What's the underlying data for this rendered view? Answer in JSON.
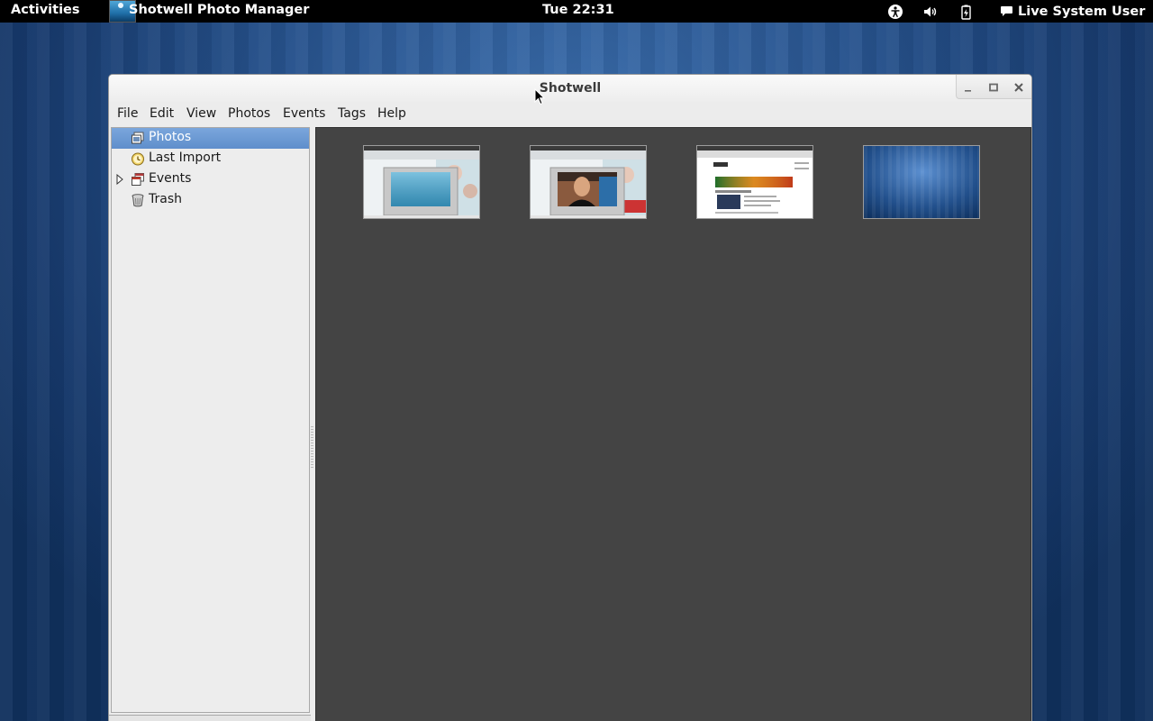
{
  "top_panel": {
    "activities_label": "Activities",
    "app_menu_label": "Shotwell Photo Manager",
    "clock": "Tue 22:31",
    "status_icons": [
      "accessibility-icon",
      "volume-icon",
      "battery-icon"
    ],
    "user_menu_label": "Live System User"
  },
  "window": {
    "title": "Shotwell",
    "controls": [
      "minimize",
      "maximize",
      "close"
    ]
  },
  "menubar": {
    "items": [
      "File",
      "Edit",
      "View",
      "Photos",
      "Events",
      "Tags",
      "Help"
    ]
  },
  "sidebar": {
    "items": [
      {
        "label": "Photos",
        "icon": "photos-icon",
        "selected": true
      },
      {
        "label": "Last Import",
        "icon": "last-import-icon",
        "selected": false
      },
      {
        "label": "Events",
        "icon": "events-icon",
        "selected": false,
        "expandable": true
      },
      {
        "label": "Trash",
        "icon": "trash-icon",
        "selected": false
      }
    ]
  },
  "photos": {
    "thumbnails": [
      {
        "kind": "desktop-screenshot-dialog"
      },
      {
        "kind": "desktop-screenshot-video"
      },
      {
        "kind": "web-page-screenshot"
      },
      {
        "kind": "blue-wallpaper"
      }
    ]
  },
  "colors": {
    "panel_bg": "#000000",
    "viewer_bg": "#444444",
    "selection_bg": "#6b97d0",
    "window_bg": "#ececec"
  }
}
